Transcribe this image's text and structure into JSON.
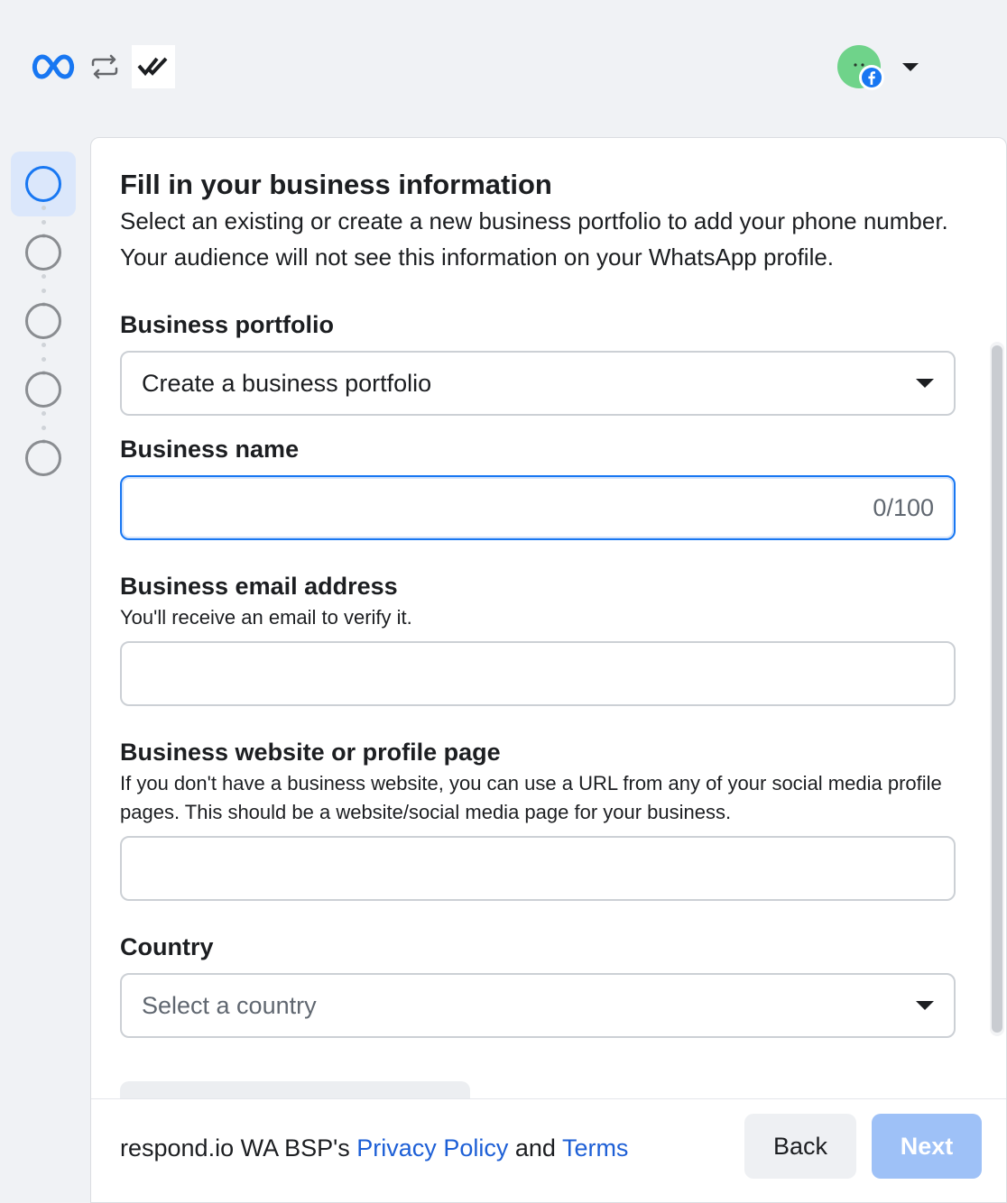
{
  "header": {
    "meta_logo_icon": "meta-logo",
    "swap_icon": "swap-arrows-icon",
    "partner_logo_icon": "double-check-logo",
    "account_avatar": "user-avatar",
    "facebook_badge_icon": "facebook-icon",
    "account_menu_icon": "caret-down-icon"
  },
  "stepper": {
    "total_steps": 5,
    "active_step": 1
  },
  "form": {
    "title": "Fill in your business information",
    "subtitle": "Select an existing or create a new business portfolio to add your phone number. Your audience will not see this information on your WhatsApp profile.",
    "business_portfolio": {
      "label": "Business portfolio",
      "value": "Create a business portfolio"
    },
    "business_name": {
      "label": "Business name",
      "value": "",
      "counter": "0/100"
    },
    "business_email": {
      "label": "Business email address",
      "helper": "You'll receive an email to verify it.",
      "value": ""
    },
    "business_website": {
      "label": "Business website or profile page",
      "helper": "If you don't have a business website, you can use a URL from any of your social media profile pages. This should be a website/social media page for your business.",
      "value": ""
    },
    "country": {
      "label": "Country",
      "placeholder": "Select a country"
    }
  },
  "footer": {
    "legal_prefix": "respond.io WA BSP's",
    "privacy_link": "Privacy Policy",
    "legal_and": "and",
    "terms_link": "Terms",
    "back_label": "Back",
    "next_label": "Next"
  },
  "colors": {
    "accent": "#1877f2",
    "link": "#1d5fd6",
    "next_disabled": "#9ec1f7"
  }
}
